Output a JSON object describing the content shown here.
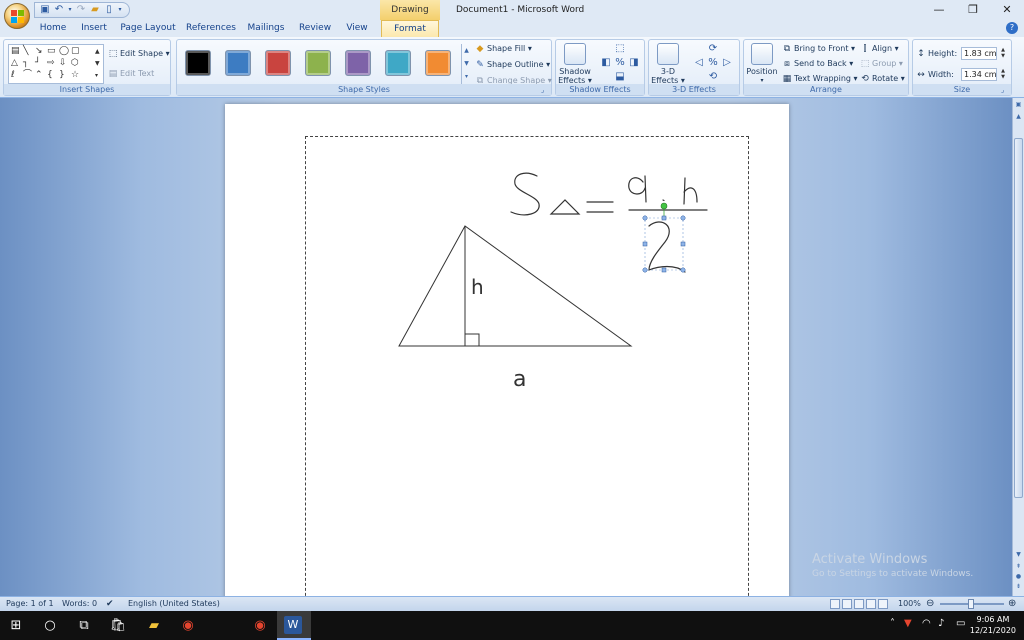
{
  "window": {
    "contextual_tab_group": "Drawing Tools",
    "title": "Document1 - Microsoft Word",
    "minimize": "—",
    "restore": "❐",
    "close": "✕"
  },
  "tabs": [
    {
      "label": "Home"
    },
    {
      "label": "Insert"
    },
    {
      "label": "Page Layout"
    },
    {
      "label": "References"
    },
    {
      "label": "Mailings"
    },
    {
      "label": "Review"
    },
    {
      "label": "View"
    },
    {
      "label": "Format"
    }
  ],
  "ribbon": {
    "insert_shapes": {
      "label": "Insert Shapes",
      "edit_shape": "Edit Shape ▾",
      "edit_text": "Edit Text"
    },
    "shape_styles": {
      "label": "Shape Styles",
      "swatches": [
        "#000000",
        "#3d7cc2",
        "#c9443f",
        "#8db24d",
        "#7e63a8",
        "#3fa8c6",
        "#f18b32"
      ],
      "shape_fill": "Shape Fill ▾",
      "shape_outline": "Shape Outline ▾",
      "change_shape": "Change Shape ▾"
    },
    "shadow_effects": {
      "label": "Shadow Effects",
      "button_line1": "Shadow",
      "button_line2": "Effects ▾"
    },
    "three_d_effects": {
      "label": "3-D Effects",
      "button_line1": "3-D",
      "button_line2": "Effects ▾"
    },
    "arrange": {
      "label": "Arrange",
      "position": "Position",
      "bring_to_front": "Bring to Front ▾",
      "send_to_back": "Send to Back ▾",
      "text_wrapping": "Text Wrapping ▾",
      "align": "Align ▾",
      "group": "Group ▾",
      "rotate": "Rotate ▾"
    },
    "size": {
      "label": "Size",
      "height_label": "Height:",
      "height_value": "1.83 cm",
      "width_label": "Width:",
      "width_value": "1.34 cm"
    }
  },
  "drawing": {
    "height_label": "h",
    "base_label": "a"
  },
  "watermark": {
    "line1": "Activate Windows",
    "line2": "Go to Settings to activate Windows."
  },
  "status": {
    "page": "Page: 1 of 1",
    "words": "Words: 0",
    "language": "English (United States)",
    "zoom": "100%"
  },
  "taskbar": {
    "time": "9:06 AM",
    "date": "12/21/2020"
  }
}
